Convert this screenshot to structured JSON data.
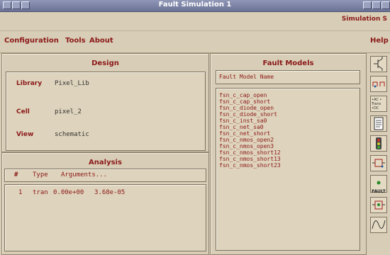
{
  "window": {
    "title": "Fault Simulation 1",
    "right_label": "Simulation  S"
  },
  "menus": {
    "configuration": "Configuration",
    "tools": "Tools",
    "about": "About",
    "help": "Help"
  },
  "design": {
    "header": "Design",
    "library_label": "Library",
    "library_value": "Pixel_Lib",
    "cell_label": "Cell",
    "cell_value": "pixel_2",
    "view_label": "View",
    "view_value": "schematic"
  },
  "analysis": {
    "header": "Analysis",
    "col_num": "#",
    "col_type": "Type",
    "col_args": "Arguments...",
    "rows": [
      {
        "num": "1",
        "type": "tran",
        "start": "0.00e+00",
        "stop": "3.68e-05"
      }
    ]
  },
  "fault_models": {
    "header": "Fault Models",
    "column_header": "Fault Model Name",
    "items": [
      "fsn_c_cap_open",
      "fsn_c_cap_short",
      "fsn_c_diode_open",
      "fsn_c_diode_short",
      "fsn_c_inst_sa0",
      "fsn_c_net_sa0",
      "fsn_c_net_short",
      "fsn_c_nmos_open2",
      "fsn_c_nmos_open3",
      "fsn_c_nmos_short12",
      "fsn_c_nmos_short13",
      "fsn_c_nmos_short23"
    ]
  },
  "toolbar": {
    "icons": [
      "transistor-icon",
      "wire-net-icon",
      "ac-dc-analysis-icon",
      "document-list-icon",
      "traffic-light-icon",
      "schematic-connect-icon",
      "fault-icon",
      "component-icon",
      "waveform-icon"
    ],
    "ac_text": "•AC • Trans •DC",
    "fault_text": "FAULT"
  },
  "colors": {
    "accent": "#8a1919",
    "background": "#d8cdb6",
    "titlebar": "#7a81a3"
  }
}
